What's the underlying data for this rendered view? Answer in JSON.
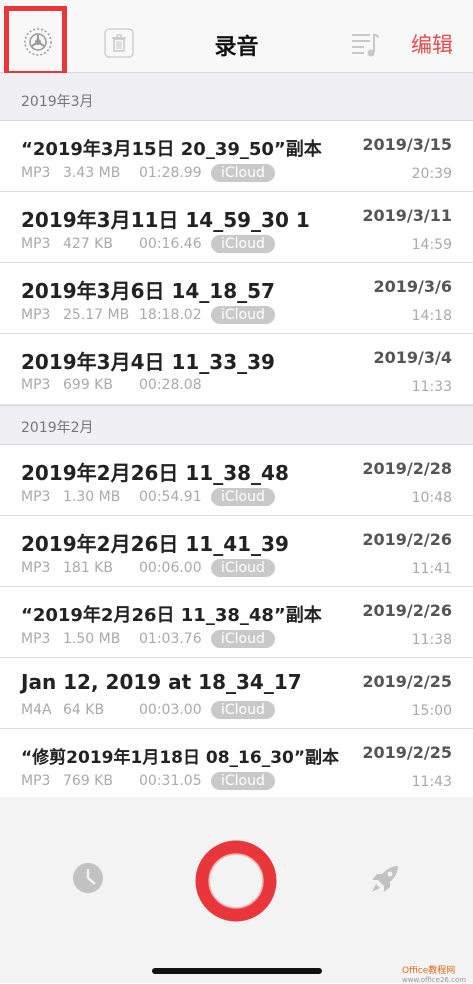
{
  "header": {
    "title": "录音",
    "edit_label": "编辑"
  },
  "sections": [
    {
      "title": "2019年3月",
      "rows": [
        {
          "name": "“2019年3月15日 20_39_50”副本",
          "date": "2019/3/15",
          "format": "MP3",
          "size": "3.43 MB",
          "duration": "01:28.99",
          "badge": "iCloud",
          "time": "20:39"
        },
        {
          "name": "2019年3月11日 14_59_30 1",
          "date": "2019/3/11",
          "format": "MP3",
          "size": "427 KB",
          "duration": "00:16.46",
          "badge": "iCloud",
          "time": "14:59"
        },
        {
          "name": "2019年3月6日 14_18_57",
          "date": "2019/3/6",
          "format": "MP3",
          "size": "25.17 MB",
          "duration": "18:18.02",
          "badge": "iCloud",
          "time": "14:18"
        },
        {
          "name": "2019年3月4日 11_33_39",
          "date": "2019/3/4",
          "format": "MP3",
          "size": "699 KB",
          "duration": "00:28.08",
          "badge": "",
          "time": "11:33"
        }
      ]
    },
    {
      "title": "2019年2月",
      "rows": [
        {
          "name": "2019年2月26日 11_38_48",
          "date": "2019/2/28",
          "format": "MP3",
          "size": "1.30 MB",
          "duration": "00:54.91",
          "badge": "iCloud",
          "time": "10:48"
        },
        {
          "name": "2019年2月26日 11_41_39",
          "date": "2019/2/26",
          "format": "MP3",
          "size": "181 KB",
          "duration": "00:06.00",
          "badge": "iCloud",
          "time": "11:41"
        },
        {
          "name": "“2019年2月26日 11_38_48”副本",
          "date": "2019/2/26",
          "format": "MP3",
          "size": "1.50 MB",
          "duration": "01:03.76",
          "badge": "iCloud",
          "time": "11:38"
        },
        {
          "name": "Jan 12, 2019 at 18_34_17",
          "date": "2019/2/25",
          "format": "M4A",
          "size": "64 KB",
          "duration": "00:03.00",
          "badge": "iCloud",
          "time": "15:00"
        },
        {
          "name": "“修剪2019年1月18日 08_16_30”副本",
          "date": "2019/2/25",
          "format": "MP3",
          "size": "769 KB",
          "duration": "00:31.05",
          "badge": "iCloud",
          "time": "11:43"
        }
      ]
    }
  ],
  "watermark": {
    "brand": "Office教程网",
    "url": "www.office26.com"
  },
  "colors": {
    "accent_red": "#e54b4b",
    "record_red": "#e8363b",
    "badge_gray": "#c9c9c9"
  },
  "icons": {
    "settings": "settings-icon",
    "trash": "trash-icon",
    "playlist": "playlist-icon",
    "history": "clock-icon",
    "record": "record-icon",
    "rocket": "rocket-icon"
  }
}
